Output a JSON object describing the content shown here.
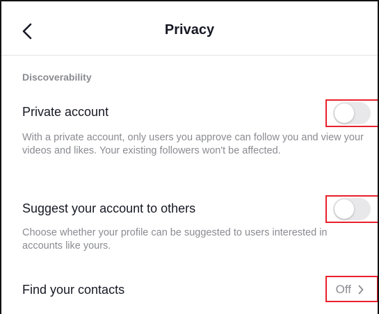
{
  "header": {
    "title": "Privacy",
    "back_icon": "chevron-left-icon"
  },
  "section": {
    "label": "Discoverability"
  },
  "settings": [
    {
      "title": "Private account",
      "description": "With a private account, only users you approve can follow you and view your videos and likes. Your existing followers won't be affected.",
      "toggle_on": false
    },
    {
      "title": "Suggest your account to others",
      "description": "Choose whether your profile can be suggested to users interested in accounts like yours.",
      "toggle_on": false
    },
    {
      "title": "Find your contacts",
      "value": "Off",
      "chevron_icon": "chevron-right-icon"
    }
  ],
  "colors": {
    "highlight": "#e8202a",
    "toggle_off": "#e8e8ea",
    "secondary_text": "#8a8b91"
  }
}
